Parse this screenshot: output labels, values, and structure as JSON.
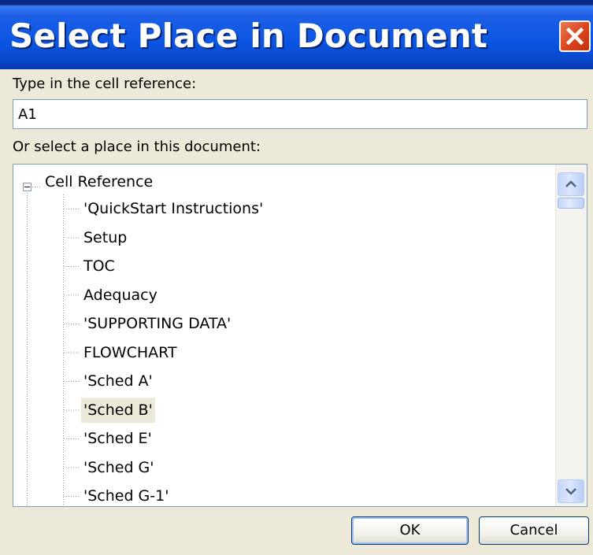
{
  "window": {
    "title": "Select Place in Document",
    "close_icon": "close-icon"
  },
  "cell_reference": {
    "label": "Type in the cell reference:",
    "value": "A1"
  },
  "place_list": {
    "label": "Or select a place in this document:",
    "root": {
      "label": "Cell Reference",
      "expanded": true,
      "expander_icon": "tree-collapse-icon"
    },
    "items": [
      {
        "label": "'QuickStart Instructions'"
      },
      {
        "label": "Setup"
      },
      {
        "label": "TOC"
      },
      {
        "label": "Adequacy"
      },
      {
        "label": "'SUPPORTING DATA'"
      },
      {
        "label": "FLOWCHART"
      },
      {
        "label": "'Sched A'"
      },
      {
        "label": "'Sched B'",
        "selected": true
      },
      {
        "label": "'Sched E'"
      },
      {
        "label": "'Sched G'"
      },
      {
        "label": "'Sched G-1'"
      }
    ],
    "scrollbar": {
      "up_icon": "chevron-up-icon",
      "down_icon": "chevron-down-icon"
    }
  },
  "buttons": {
    "ok": "OK",
    "cancel": "Cancel"
  },
  "colors": {
    "titlebar": "#0a55e3",
    "close_button": "#d8431d",
    "dialog_background": "#ece9d8",
    "selection_background": "#ece9d8",
    "field_border": "#7f9db9"
  }
}
